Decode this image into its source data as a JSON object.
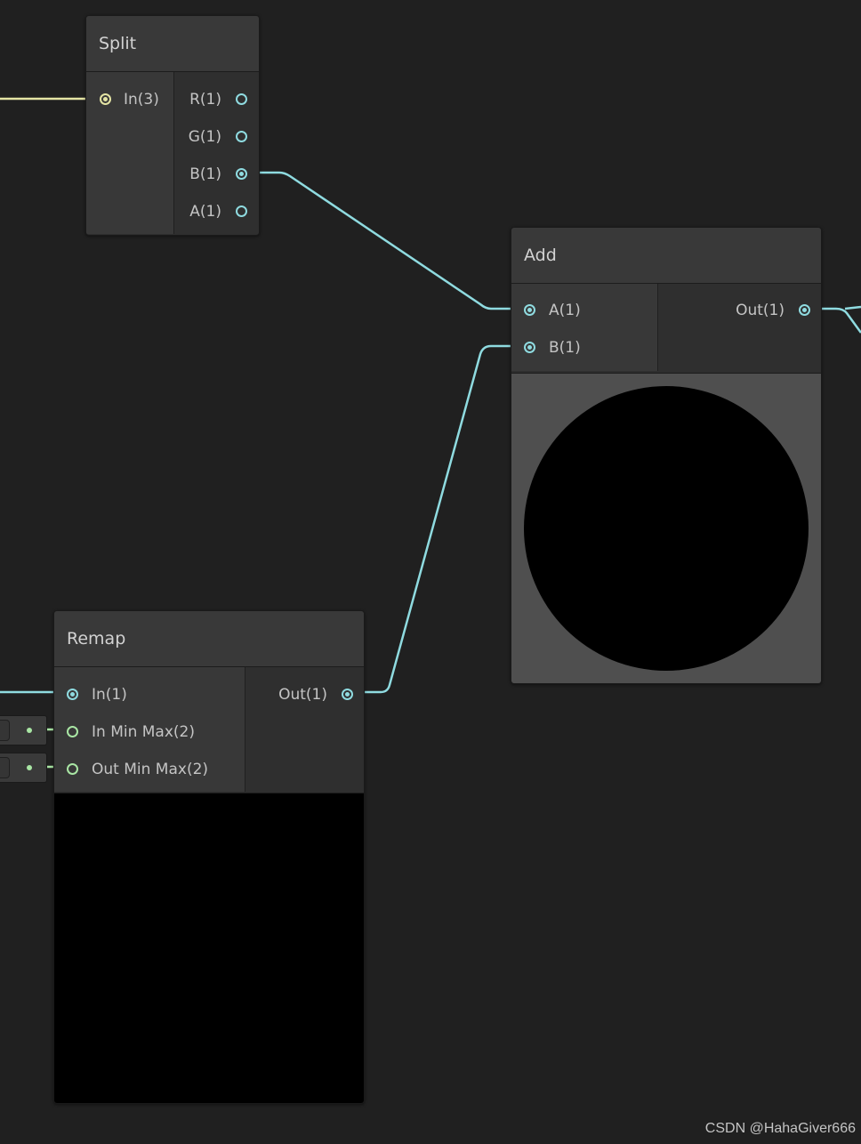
{
  "colors": {
    "background": "#202020",
    "vector1_wire": "#8fdbe0",
    "vector2_port": "#a9e6a4",
    "vector3_wire": "#e4e4a4",
    "preview_gray": "#4f4f4f",
    "preview_black": "#000000"
  },
  "nodes": {
    "split": {
      "title": "Split",
      "inputs": [
        {
          "label": "In(3)"
        }
      ],
      "outputs": [
        {
          "label": "R(1)"
        },
        {
          "label": "G(1)"
        },
        {
          "label": "B(1)"
        },
        {
          "label": "A(1)"
        }
      ]
    },
    "add": {
      "title": "Add",
      "inputs": [
        {
          "label": "A(1)"
        },
        {
          "label": "B(1)"
        }
      ],
      "outputs": [
        {
          "label": "Out(1)"
        }
      ],
      "preview": "black circle on gray"
    },
    "remap": {
      "title": "Remap",
      "inputs": [
        {
          "label": "In(1)"
        },
        {
          "label": "In Min Max(2)"
        },
        {
          "label": "Out Min Max(2)"
        }
      ],
      "outputs": [
        {
          "label": "Out(1)"
        }
      ],
      "preview": "solid black"
    }
  },
  "watermark": "CSDN @HahaGiver666"
}
